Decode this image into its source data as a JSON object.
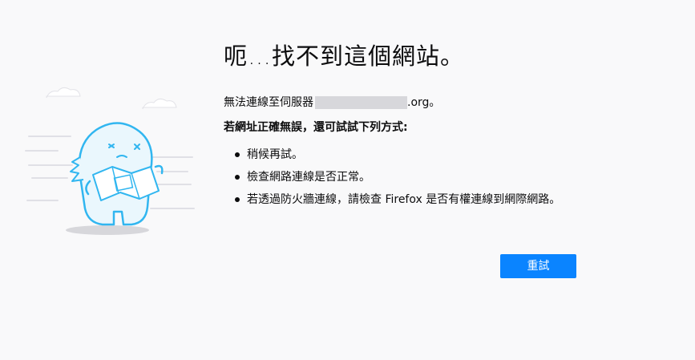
{
  "error": {
    "title": "呃…找不到這個網站。",
    "description_prefix": "無法連線至伺服器",
    "description_suffix": ".org。",
    "suggestions_heading": "若網址正確無誤，還可試試下列方式:",
    "suggestions": [
      "稍候再試。",
      "檢查網路連線是否正常。",
      "若透過防火牆連線，請檢查 Firefox 是否有權連線到網際網路。"
    ]
  },
  "actions": {
    "try_again_label": "重試"
  },
  "colors": {
    "background": "#f9f9fa",
    "accent": "#0a84ff",
    "illustration": "#31b6f0"
  },
  "illustration": {
    "icon": "lost-dino-with-map-icon"
  }
}
